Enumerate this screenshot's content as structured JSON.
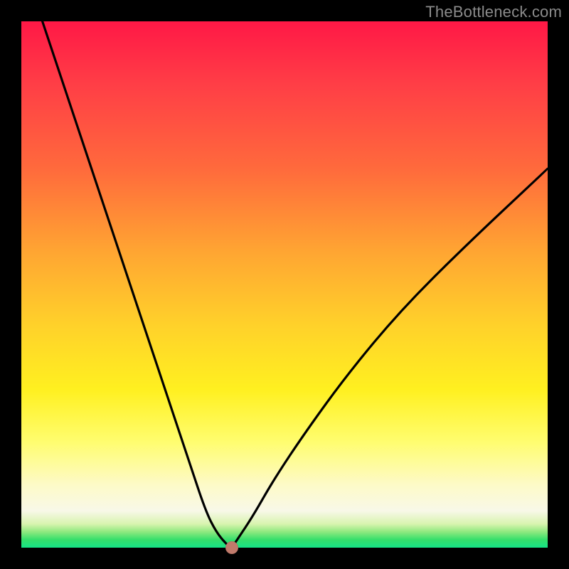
{
  "watermark": "TheBottleneck.com",
  "chart_data": {
    "type": "line",
    "title": "",
    "xlabel": "",
    "ylabel": "",
    "xlim": [
      0,
      100
    ],
    "ylim": [
      0,
      100
    ],
    "series": [
      {
        "name": "bottleneck-curve",
        "x": [
          4,
          8,
          12,
          16,
          20,
          24,
          28,
          32,
          35,
          37,
          39,
          40,
          41,
          44,
          48,
          54,
          62,
          72,
          84,
          100
        ],
        "values": [
          100,
          88,
          76,
          64,
          52,
          40,
          28,
          16,
          7,
          3,
          0.6,
          0,
          1.5,
          6,
          13,
          22,
          33,
          45,
          57,
          72
        ]
      }
    ],
    "marker": {
      "x": 40,
      "y": 0,
      "color": "#c07a6b"
    },
    "background_gradient": {
      "top": "#ff1846",
      "bottom": "#15e387"
    }
  }
}
